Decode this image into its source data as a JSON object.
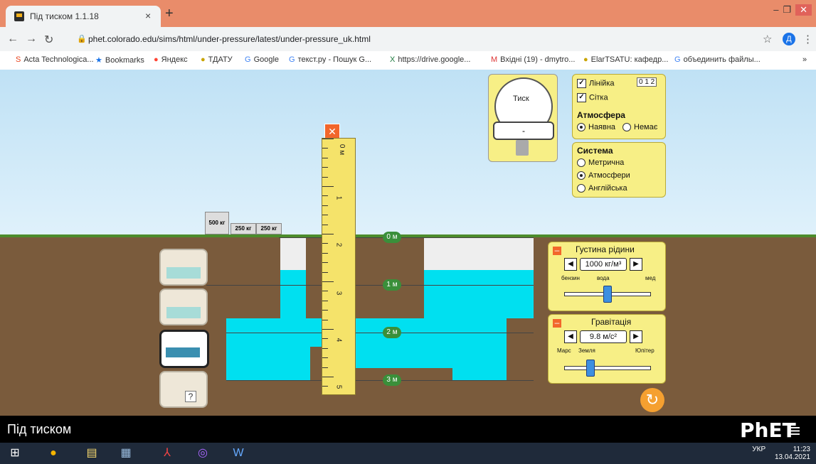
{
  "browser": {
    "tab_title": "Під тиском 1.1.18",
    "tab_close": "×",
    "new_tab": "+",
    "url": "phet.colorado.edu/sims/html/under-pressure/latest/under-pressure_uk.html",
    "avatar_letter": "Д",
    "bookmarks": [
      "Acta Technologica...",
      "Bookmarks",
      "Яндекс",
      "ТДАТУ",
      "Google",
      "текст.ру - Пошук G...",
      "https://drive.google...",
      "Вхідні (19) - dmytro...",
      "ElarTSATU: кафедр...",
      "объединить файлы..."
    ],
    "bookmarks_more": "»"
  },
  "sim": {
    "title": "Під тиском",
    "masses": [
      "500 кг",
      "250 кг",
      "250 кг"
    ],
    "depth_markers": [
      "0 м",
      "1 м",
      "2 м",
      "3 м"
    ],
    "ruler_numbers": [
      "0 м",
      "1",
      "2",
      "3",
      "4",
      "5"
    ],
    "scene_unknown_label": "?",
    "gauge": {
      "label": "Тиск",
      "reading": "-"
    },
    "view_panel": {
      "ruler": "Лінійка",
      "grid": "Сітка",
      "ruler_icon": "0 1 2",
      "atmosphere_title": "Атмосфера",
      "atm_on": "Наявна",
      "atm_off": "Немає"
    },
    "units_panel": {
      "title": "Система",
      "options": [
        "Метрична",
        "Атмосфери",
        "Англійська"
      ],
      "selected": "Атмосфери"
    },
    "density_panel": {
      "title": "Густина рідини",
      "value": "1000 кг/м³",
      "labels": [
        "бензин",
        "вода",
        "мед"
      ],
      "level": 0.5
    },
    "gravity_panel": {
      "title": "Гравітація",
      "value": "9.8 м/с²",
      "labels": [
        "Марс",
        "Земля",
        "Юпітер"
      ],
      "level": 0.3
    },
    "brand": "PhET"
  },
  "taskbar": {
    "lang": "УКР",
    "time": "11:23",
    "date": "13.04.2021"
  }
}
